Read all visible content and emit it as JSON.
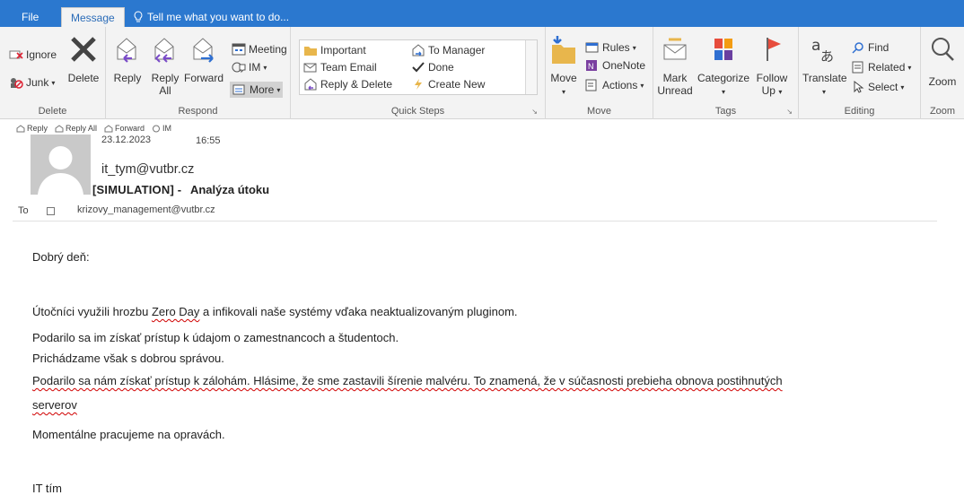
{
  "tabs": {
    "file": "File",
    "message": "Message",
    "tell_me": "Tell me what you want to do..."
  },
  "groups": {
    "delete": {
      "label": "Delete",
      "ignore": "Ignore",
      "junk": "Junk",
      "junk_arrow": "▾",
      "delete": "Delete"
    },
    "respond": {
      "label": "Respond",
      "reply": "Reply",
      "reply_all_1": "Reply",
      "reply_all_2": "All",
      "forward": "Forward",
      "meeting": "Meeting",
      "im": "IM",
      "im_arrow": "▾",
      "more": "More",
      "more_arrow": "▾"
    },
    "quick_steps": {
      "label": "Quick Steps",
      "important": "Important",
      "team_email": "Team Email",
      "reply_delete": "Reply & Delete",
      "to_manager": "To Manager",
      "done": "Done",
      "create_new": "Create New",
      "launcher": "↘"
    },
    "move": {
      "label": "Move",
      "move": "Move",
      "move_arrow": "▾",
      "rules": "Rules",
      "rules_arrow": "▾",
      "onenote": "OneNote",
      "actions": "Actions",
      "actions_arrow": "▾"
    },
    "tags": {
      "label": "Tags",
      "mark_unread_1": "Mark",
      "mark_unread_2": "Unread",
      "categorize": "Categorize",
      "categorize_arrow": "▾",
      "follow_up_1": "Follow",
      "follow_up_2": "Up",
      "follow_up_arrow": "▾",
      "launcher": "↘"
    },
    "editing": {
      "label": "Editing",
      "translate": "Translate",
      "translate_arrow": "▾",
      "find": "Find",
      "related": "Related",
      "related_arrow": "▾",
      "select": "Select",
      "select_arrow": "▾"
    },
    "zoom": {
      "label": "Zoom",
      "zoom": "Zoom"
    }
  },
  "message_toolbar": {
    "reply": "Reply",
    "reply_all": "Reply All",
    "forward": "Forward",
    "im": "IM"
  },
  "header": {
    "date": "23.12.2023",
    "time": "16:55",
    "from": "it_tym@vutbr.cz",
    "subject_prefix": "[SIMULATION] -",
    "subject_main": "Analýza útoku",
    "to_label": "To",
    "to_email": "krizovy_management@vutbr.cz"
  },
  "body": {
    "greeting": "Dobrý deň:",
    "p1_a": "Útočníci využili hrozbu ",
    "p1_b": "Zero Day",
    "p1_c": " a infikovali naše systémy vďaka neaktualizovaným pluginom.",
    "p2": "Podarilo sa im získať prístup k údajom o zamestnancoch a študentoch.",
    "p3": "Prichádzame však s dobrou správou.",
    "p4_line1": "Podarilo sa nám získať prístup k zálohám. Hlásime, že sme zastavili šírenie malvéru. To znamená, že v súčasnosti prebieha obnova postihnutých",
    "p4_line2": "serverov",
    "p5": "Momentálne pracujeme na opravách.",
    "signature": "IT tím"
  }
}
